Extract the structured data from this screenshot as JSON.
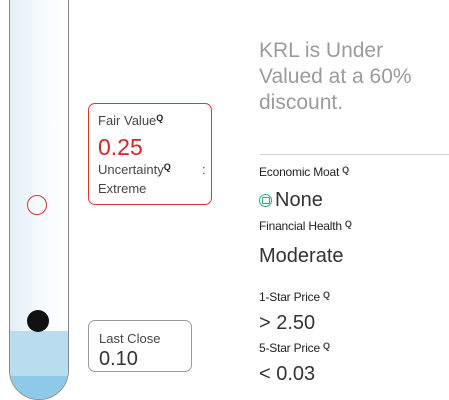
{
  "gauge": {
    "colors": {
      "accent": "#d7232b",
      "band": "#b9dcef"
    }
  },
  "fair_value": {
    "label": "Fair Value",
    "value": "0.25",
    "uncertainty_label": "Uncertainty",
    "uncertainty_sep": ":",
    "uncertainty_value": "Extreme"
  },
  "last_close": {
    "label": "Last Close",
    "value": "0.10"
  },
  "summary": {
    "headline": "KRL is Under Valued at a 60% discount."
  },
  "economic_moat": {
    "label": "Economic Moat",
    "value": "None",
    "icon": "moat-none-icon"
  },
  "financial_health": {
    "label": "Financial Health",
    "value": "Moderate"
  },
  "one_star_price": {
    "label": "1-Star Price",
    "value": "> 2.50"
  },
  "five_star_price": {
    "label": "5-Star Price",
    "value": "< 0.03"
  },
  "info_icon_glyph": "Q"
}
